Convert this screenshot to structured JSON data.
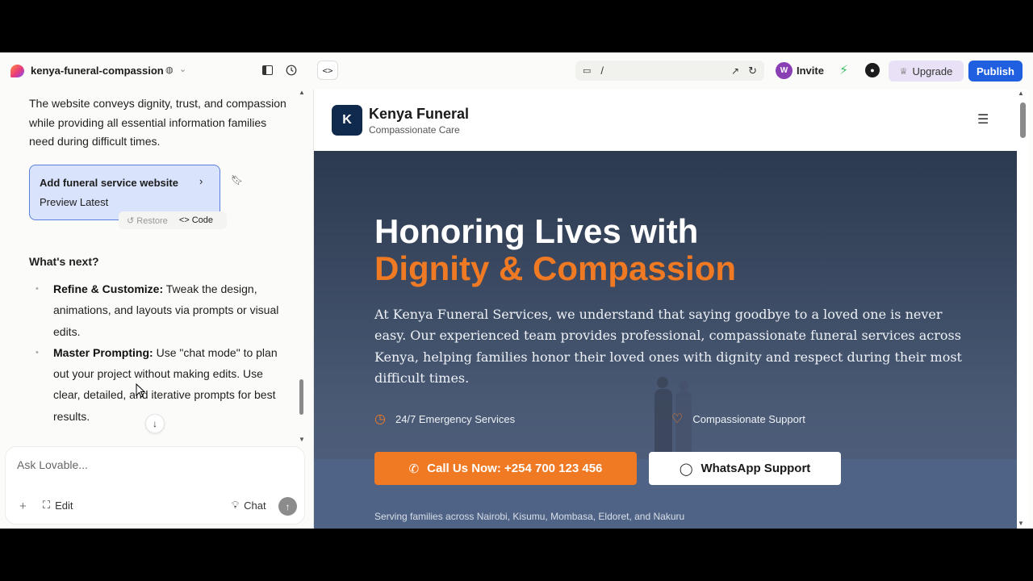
{
  "topbar": {
    "project_name": "kenya-funeral-compassion",
    "url_path": "/",
    "avatar_initial": "W",
    "invite_label": "Invite",
    "upgrade_label": "Upgrade",
    "publish_label": "Publish",
    "colors": {
      "publish": "#1f5fe0",
      "upgrade_bg": "#e9e2f6",
      "avatar": "#8b3fb5"
    }
  },
  "chat": {
    "intro_text": "The website conveys dignity, trust, and compassion while providing all essential information families need during difficult times.",
    "card": {
      "title": "Add funeral service website",
      "subtitle": "Preview Latest"
    },
    "restore_label": "Restore",
    "code_label": "Code",
    "next_heading": "What's next?",
    "bullets": [
      {
        "title": "Refine & Customize:",
        "text": " Tweak the design, animations, and layouts via prompts or visual edits."
      },
      {
        "title": "Master Prompting:",
        "text": " Use \"chat mode\" to plan out your project without making edits. Use clear, detailed, and iterative prompts for best results."
      }
    ],
    "composer": {
      "placeholder": "Ask Lovable...",
      "edit_label": "Edit",
      "chat_label": "Chat"
    }
  },
  "preview": {
    "site_logo_letter": "K",
    "site_name": "Kenya Funeral",
    "site_tagline": "Compassionate Care",
    "hero": {
      "title_line1": "Honoring Lives with",
      "title_line2": "Dignity & Compassion",
      "paragraph": "At Kenya Funeral Services, we understand that saying goodbye to a loved one is never easy. Our experienced team provides professional, compassionate funeral services across Kenya, helping families honor their loved ones with dignity and respect during their most difficult times.",
      "feature1": "24/7 Emergency Services",
      "feature2": "Compassionate Support",
      "call_button": "Call Us Now: +254 700 123 456",
      "whatsapp_button": "WhatsApp Support",
      "serving_text": "Serving families across Nairobi, Kisumu, Mombasa, Eldoret, and Nakuru"
    },
    "colors": {
      "accent": "#f07a24",
      "logo_bg": "#0f2a4c"
    }
  }
}
